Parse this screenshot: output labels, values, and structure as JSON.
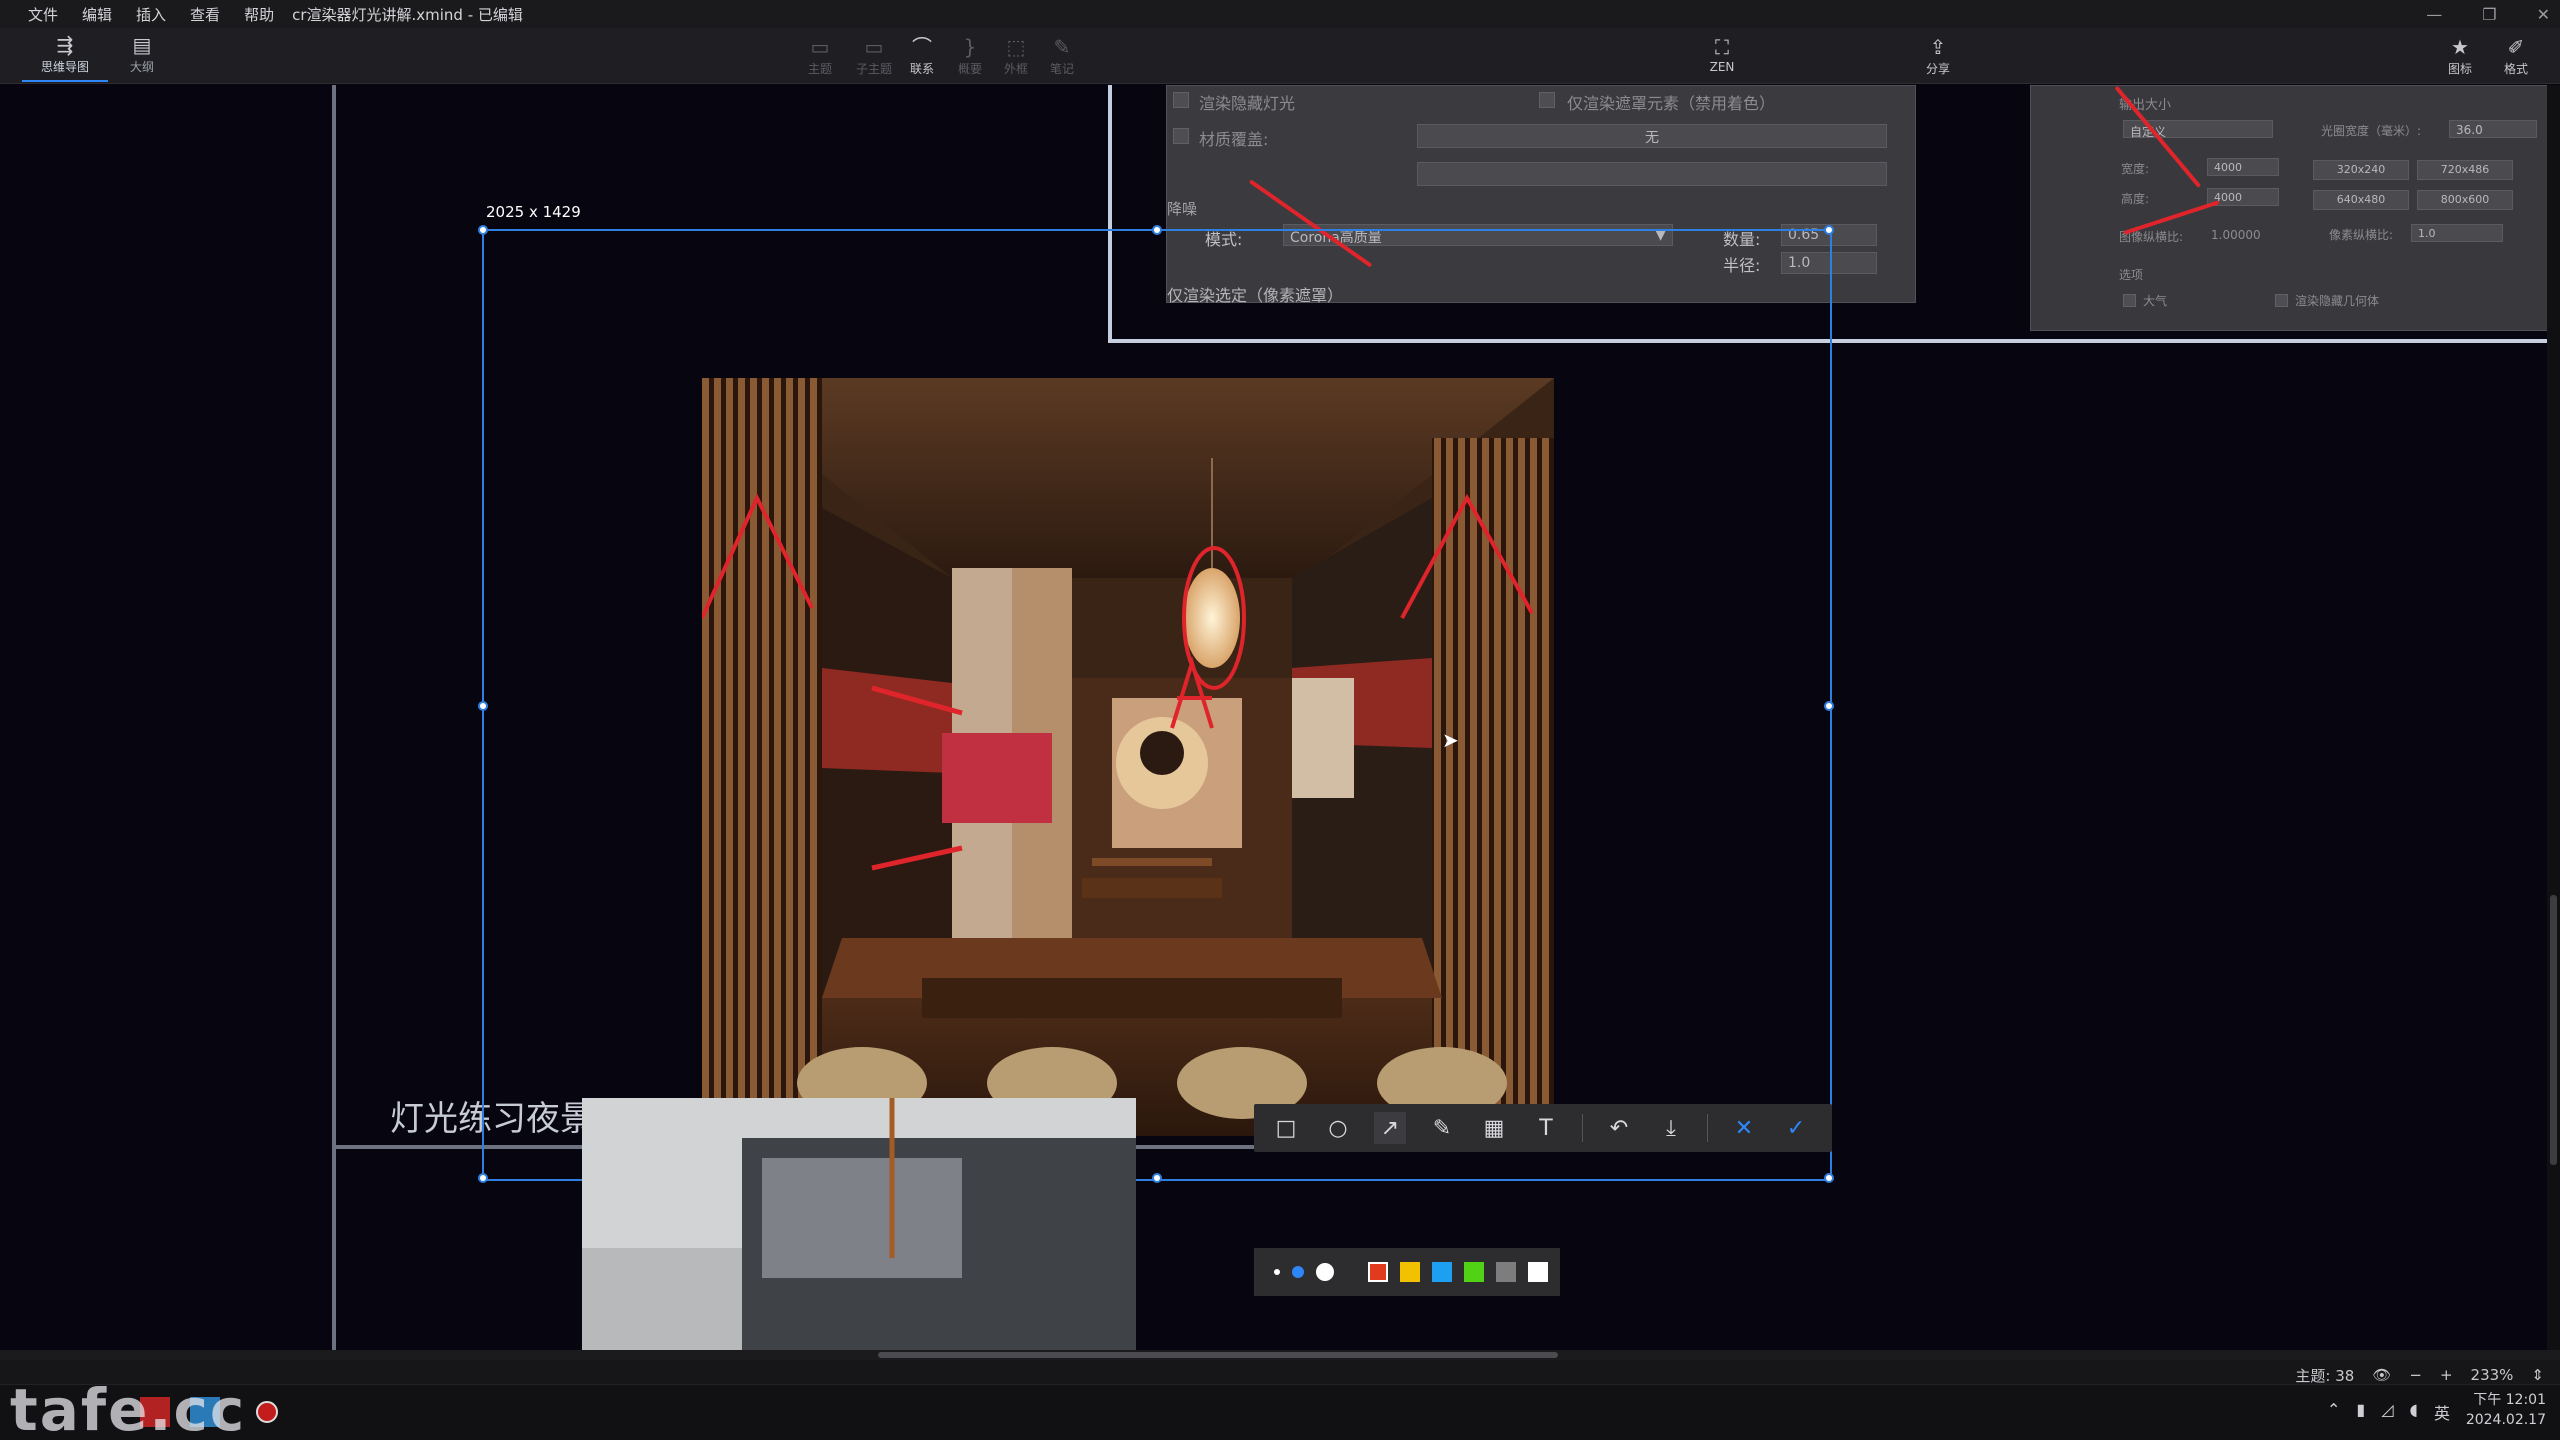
{
  "menu": [
    "文件",
    "编辑",
    "插入",
    "查看",
    "帮助"
  ],
  "doc_title": "cr渲染器灯光讲解.xmind - 已编辑",
  "view_tabs": [
    {
      "label": "思维导图",
      "icon": "mindmap-icon"
    },
    {
      "label": "大纲",
      "icon": "outline-icon"
    }
  ],
  "insert_tools": [
    {
      "label": "主题",
      "icon": "topic-icon"
    },
    {
      "label": "子主题",
      "icon": "subtopic-icon"
    },
    {
      "label": "联系",
      "icon": "relationship-icon"
    },
    {
      "label": "概要",
      "icon": "summary-icon"
    },
    {
      "label": "外框",
      "icon": "boundary-icon"
    },
    {
      "label": "笔记",
      "icon": "note-icon"
    }
  ],
  "zen_label": "ZEN",
  "share_label": "分享",
  "right_tools": [
    {
      "label": "图标",
      "icon": "star-icon"
    },
    {
      "label": "格式",
      "icon": "brush-icon"
    }
  ],
  "render_panel": {
    "hide_lights": "渲染隐藏灯光",
    "mask_only": "仅渲染遮罩元素（禁用着色）",
    "material_override": "材质覆盖:",
    "none": "无",
    "denoise": "降噪",
    "mode_label": "模式:",
    "mode_value": "Corona高质量",
    "amount_label": "数量:",
    "amount_value": "0.65",
    "radius_label": "半径:",
    "radius_value": "1.0",
    "render_selected": "仅渲染选定（像素遮罩）"
  },
  "output_panel": {
    "title": "输出大小",
    "custom": "自定义",
    "aperture_label": "光圈宽度（毫米）:",
    "aperture_value": "36.0",
    "width_label": "宽度:",
    "width_value": "4000",
    "height_label": "高度:",
    "height_value": "4000",
    "presets": [
      "320x240",
      "720x486",
      "640x480",
      "800x600"
    ],
    "aspect_label": "图像纵横比:",
    "aspect_value": "1.00000",
    "pixel_aspect_label": "像素纵横比:",
    "pixel_aspect_value": "1.0",
    "options_label": "选项",
    "atmosphere": "大气",
    "hide_geometry": "渲染隐藏几何体"
  },
  "selection_size": "2025 x 1429",
  "node_label": "灯光练习夜景",
  "annotation_tools": [
    {
      "name": "rectangle-tool",
      "glyph": "□"
    },
    {
      "name": "ellipse-tool",
      "glyph": "○"
    },
    {
      "name": "arrow-tool",
      "glyph": "↗"
    },
    {
      "name": "pen-tool",
      "glyph": "✎"
    },
    {
      "name": "mosaic-tool",
      "glyph": "▦"
    },
    {
      "name": "text-tool",
      "glyph": "T"
    },
    {
      "name": "undo-tool",
      "glyph": "↶"
    },
    {
      "name": "download-tool",
      "glyph": "⤓"
    },
    {
      "name": "cancel-tool",
      "glyph": "✕"
    },
    {
      "name": "confirm-tool",
      "glyph": "✓"
    }
  ],
  "palette_colors": [
    "#e23a1d",
    "#f2c200",
    "#1ea0f2",
    "#52d215",
    "#7d7d7d",
    "#ffffff"
  ],
  "accent_color": "#2f7fe0",
  "status": {
    "topics": "主题: 38",
    "zoom": "233%"
  },
  "tray": {
    "ime": "英",
    "time": "下午 12:01",
    "date": "2024.02.17"
  },
  "watermark": "tafe.cc"
}
